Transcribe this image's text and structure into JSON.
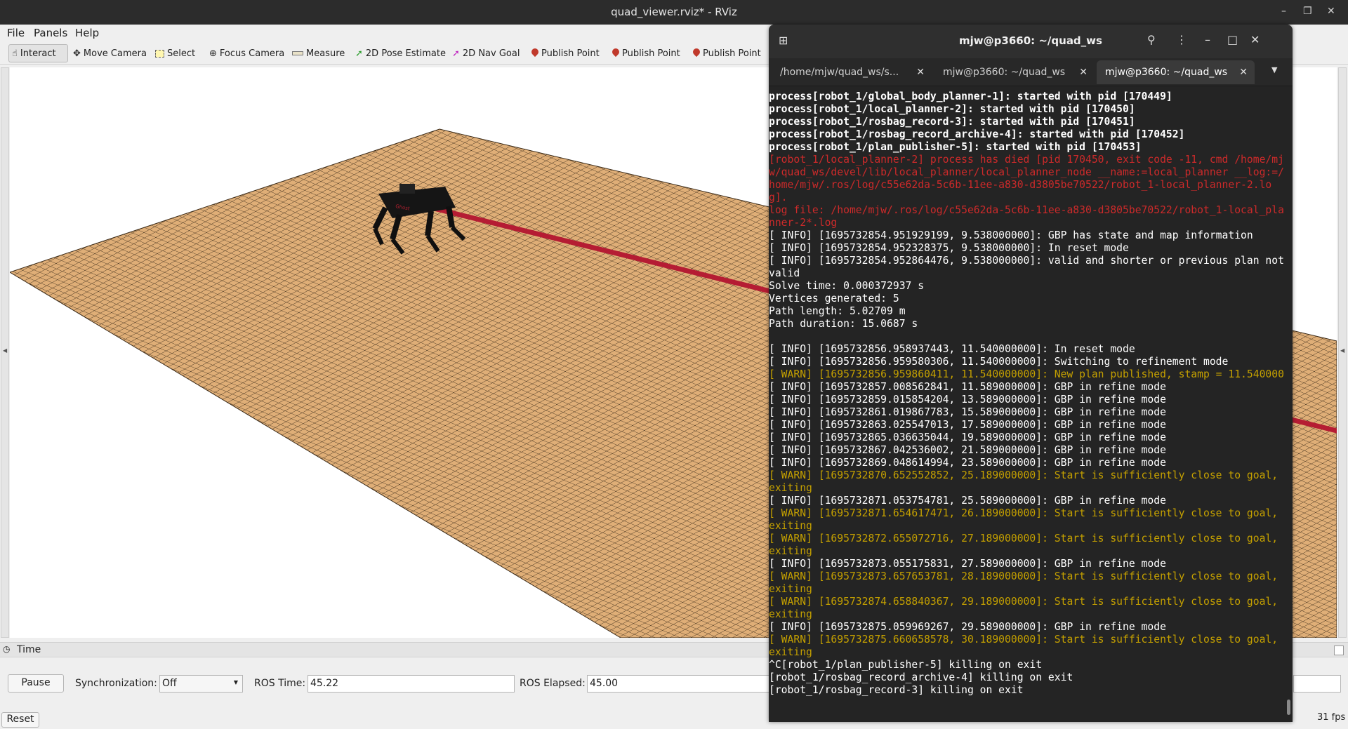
{
  "window": {
    "title": "quad_viewer.rviz* - RViz"
  },
  "menu": {
    "file": "File",
    "panels": "Panels",
    "help": "Help"
  },
  "toolbar": {
    "interact": "Interact",
    "move_camera": "Move Camera",
    "select": "Select",
    "focus_camera": "Focus Camera",
    "measure": "Measure",
    "pose_estimate": "2D Pose Estimate",
    "nav_goal": "2D Nav Goal",
    "publish_point_1": "Publish Point",
    "publish_point_2": "Publish Point",
    "publish_point_3": "Publish Point"
  },
  "time_panel": {
    "title": "Time",
    "pause": "Pause",
    "sync_label": "Synchronization:",
    "sync_value": "Off",
    "ros_time_label": "ROS Time:",
    "ros_time_value": "45.22",
    "ros_elapsed_label": "ROS Elapsed:",
    "ros_elapsed_value": "45.00",
    "reset": "Reset",
    "fps": "31 fps"
  },
  "terminal": {
    "title": "mjw@p3660: ~/quad_ws",
    "tabs": [
      {
        "label": "/home/mjw/quad_ws/s..."
      },
      {
        "label": "mjw@p3660: ~/quad_ws"
      },
      {
        "label": "mjw@p3660: ~/quad_ws"
      }
    ],
    "lines": [
      {
        "kind": "proc",
        "text": "process[robot_1/global_body_planner-1]: started with pid [170449]"
      },
      {
        "kind": "proc",
        "text": "process[robot_1/local_planner-2]: started with pid [170450]"
      },
      {
        "kind": "proc",
        "text": "process[robot_1/rosbag_record-3]: started with pid [170451]"
      },
      {
        "kind": "proc",
        "text": "process[robot_1/rosbag_record_archive-4]: started with pid [170452]"
      },
      {
        "kind": "proc",
        "text": "process[robot_1/plan_publisher-5]: started with pid [170453]"
      },
      {
        "kind": "err",
        "text": "[robot_1/local_planner-2] process has died [pid 170450, exit code -11, cmd /home/mjw/quad_ws/devel/lib/local_planner/local_planner_node __name:=local_planner __log:=/home/mjw/.ros/log/c55e62da-5c6b-11ee-a830-d3805be70522/robot_1-local_planner-2.log]."
      },
      {
        "kind": "err",
        "text": "log file: /home/mjw/.ros/log/c55e62da-5c6b-11ee-a830-d3805be70522/robot_1-local_planner-2*.log"
      },
      {
        "kind": "info",
        "text": "[ INFO] [1695732854.951929199, 9.538000000]: GBP has state and map information"
      },
      {
        "kind": "info",
        "text": "[ INFO] [1695732854.952328375, 9.538000000]: In reset mode"
      },
      {
        "kind": "info",
        "text": "[ INFO] [1695732854.952864476, 9.538000000]: valid and shorter or previous plan not valid"
      },
      {
        "kind": "info",
        "text": "Solve time: 0.000372937 s"
      },
      {
        "kind": "info",
        "text": "Vertices generated: 5"
      },
      {
        "kind": "info",
        "text": "Path length: 5.02709 m"
      },
      {
        "kind": "info",
        "text": "Path duration: 15.0687 s"
      },
      {
        "kind": "info",
        "text": " "
      },
      {
        "kind": "info",
        "text": "[ INFO] [1695732856.958937443, 11.540000000]: In reset mode"
      },
      {
        "kind": "info",
        "text": "[ INFO] [1695732856.959580306, 11.540000000]: Switching to refinement mode"
      },
      {
        "kind": "warn",
        "text": "[ WARN] [1695732856.959860411, 11.540000000]: New plan published, stamp = 11.540000"
      },
      {
        "kind": "info",
        "text": "[ INFO] [1695732857.008562841, 11.589000000]: GBP in refine mode"
      },
      {
        "kind": "info",
        "text": "[ INFO] [1695732859.015854204, 13.589000000]: GBP in refine mode"
      },
      {
        "kind": "info",
        "text": "[ INFO] [1695732861.019867783, 15.589000000]: GBP in refine mode"
      },
      {
        "kind": "info",
        "text": "[ INFO] [1695732863.025547013, 17.589000000]: GBP in refine mode"
      },
      {
        "kind": "info",
        "text": "[ INFO] [1695732865.036635044, 19.589000000]: GBP in refine mode"
      },
      {
        "kind": "info",
        "text": "[ INFO] [1695732867.042536002, 21.589000000]: GBP in refine mode"
      },
      {
        "kind": "info",
        "text": "[ INFO] [1695732869.048614994, 23.589000000]: GBP in refine mode"
      },
      {
        "kind": "warn",
        "text": "[ WARN] [1695732870.652552852, 25.189000000]: Start is sufficiently close to goal, exiting"
      },
      {
        "kind": "info",
        "text": "[ INFO] [1695732871.053754781, 25.589000000]: GBP in refine mode"
      },
      {
        "kind": "warn",
        "text": "[ WARN] [1695732871.654617471, 26.189000000]: Start is sufficiently close to goal, exiting"
      },
      {
        "kind": "warn",
        "text": "[ WARN] [1695732872.655072716, 27.189000000]: Start is sufficiently close to goal, exiting"
      },
      {
        "kind": "info",
        "text": "[ INFO] [1695732873.055175831, 27.589000000]: GBP in refine mode"
      },
      {
        "kind": "warn",
        "text": "[ WARN] [1695732873.657653781, 28.189000000]: Start is sufficiently close to goal, exiting"
      },
      {
        "kind": "warn",
        "text": "[ WARN] [1695732874.658840367, 29.189000000]: Start is sufficiently close to goal, exiting"
      },
      {
        "kind": "info",
        "text": "[ INFO] [1695732875.059969267, 29.589000000]: GBP in refine mode"
      },
      {
        "kind": "warn",
        "text": "[ WARN] [1695732875.660658578, 30.189000000]: Start is sufficiently close to goal, exiting"
      },
      {
        "kind": "info",
        "text": "^C[robot_1/plan_publisher-5] killing on exit"
      },
      {
        "kind": "info",
        "text": "[robot_1/rosbag_record_archive-4] killing on exit"
      },
      {
        "kind": "info",
        "text": "[robot_1/rosbag_record-3] killing on exit"
      }
    ]
  },
  "colors": {
    "ground": "#dfae77",
    "grid_line": "#3a2a18",
    "plan_path": "#b51c33",
    "terminal_bg": "#242424",
    "warn": "#c4a000",
    "error": "#cc2a2a"
  }
}
